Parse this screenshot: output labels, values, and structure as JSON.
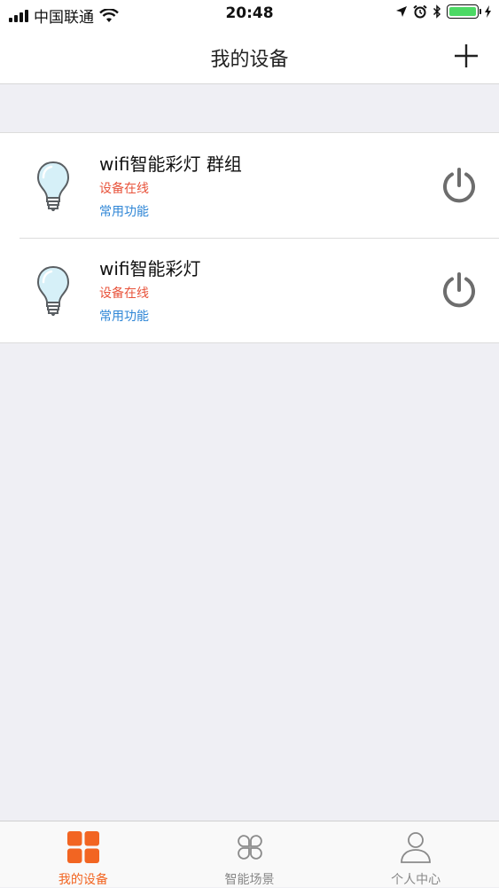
{
  "status_bar": {
    "carrier": "中国联通",
    "time": "20:48",
    "battery_level": 1.0,
    "battery_color": "#4cd964"
  },
  "nav": {
    "title": "我的设备",
    "add_icon": "plus-icon"
  },
  "devices": [
    {
      "name": "wifi智能彩灯 群组",
      "status": "设备在线",
      "function_link": "常用功能",
      "icon": "light-bulb-icon",
      "power_icon": "power-icon"
    },
    {
      "name": "wifi智能彩灯",
      "status": "设备在线",
      "function_link": "常用功能",
      "icon": "light-bulb-icon",
      "power_icon": "power-icon"
    }
  ],
  "tabs": [
    {
      "label": "我的设备",
      "icon": "grid-icon",
      "active": true
    },
    {
      "label": "智能场景",
      "icon": "clover-icon",
      "active": false
    },
    {
      "label": "个人中心",
      "icon": "person-icon",
      "active": false
    }
  ],
  "colors": {
    "accent": "#f26522",
    "status_online": "#e8533b",
    "link": "#2f86d6",
    "background": "#efeff4"
  }
}
